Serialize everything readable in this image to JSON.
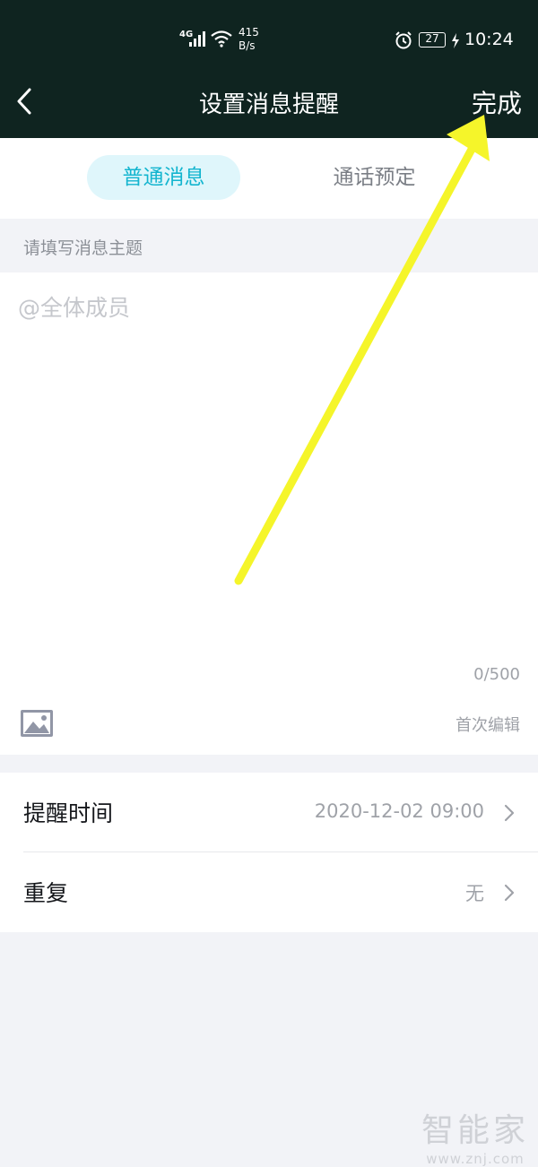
{
  "status_bar": {
    "network": "4G",
    "speed_value": "415",
    "speed_unit": "B/s",
    "battery": "27",
    "time": "10:24"
  },
  "nav": {
    "title": "设置消息提醒",
    "done_label": "完成"
  },
  "tabs": [
    {
      "label": "普通消息",
      "active": true
    },
    {
      "label": "通话预定",
      "active": false
    }
  ],
  "subject": {
    "placeholder": "请填写消息主题"
  },
  "editor": {
    "placeholder": "@全体成员",
    "counter": "0/500",
    "edit_hint": "首次编辑"
  },
  "settings": [
    {
      "label": "提醒时间",
      "value": "2020-12-02 09:00"
    },
    {
      "label": "重复",
      "value": "无"
    }
  ],
  "watermark": {
    "main": "智能家",
    "sub": "www.znj.com"
  },
  "colors": {
    "header_bg": "#0f2420",
    "accent": "#13b5cf",
    "annotation_arrow": "#f5f52a"
  }
}
